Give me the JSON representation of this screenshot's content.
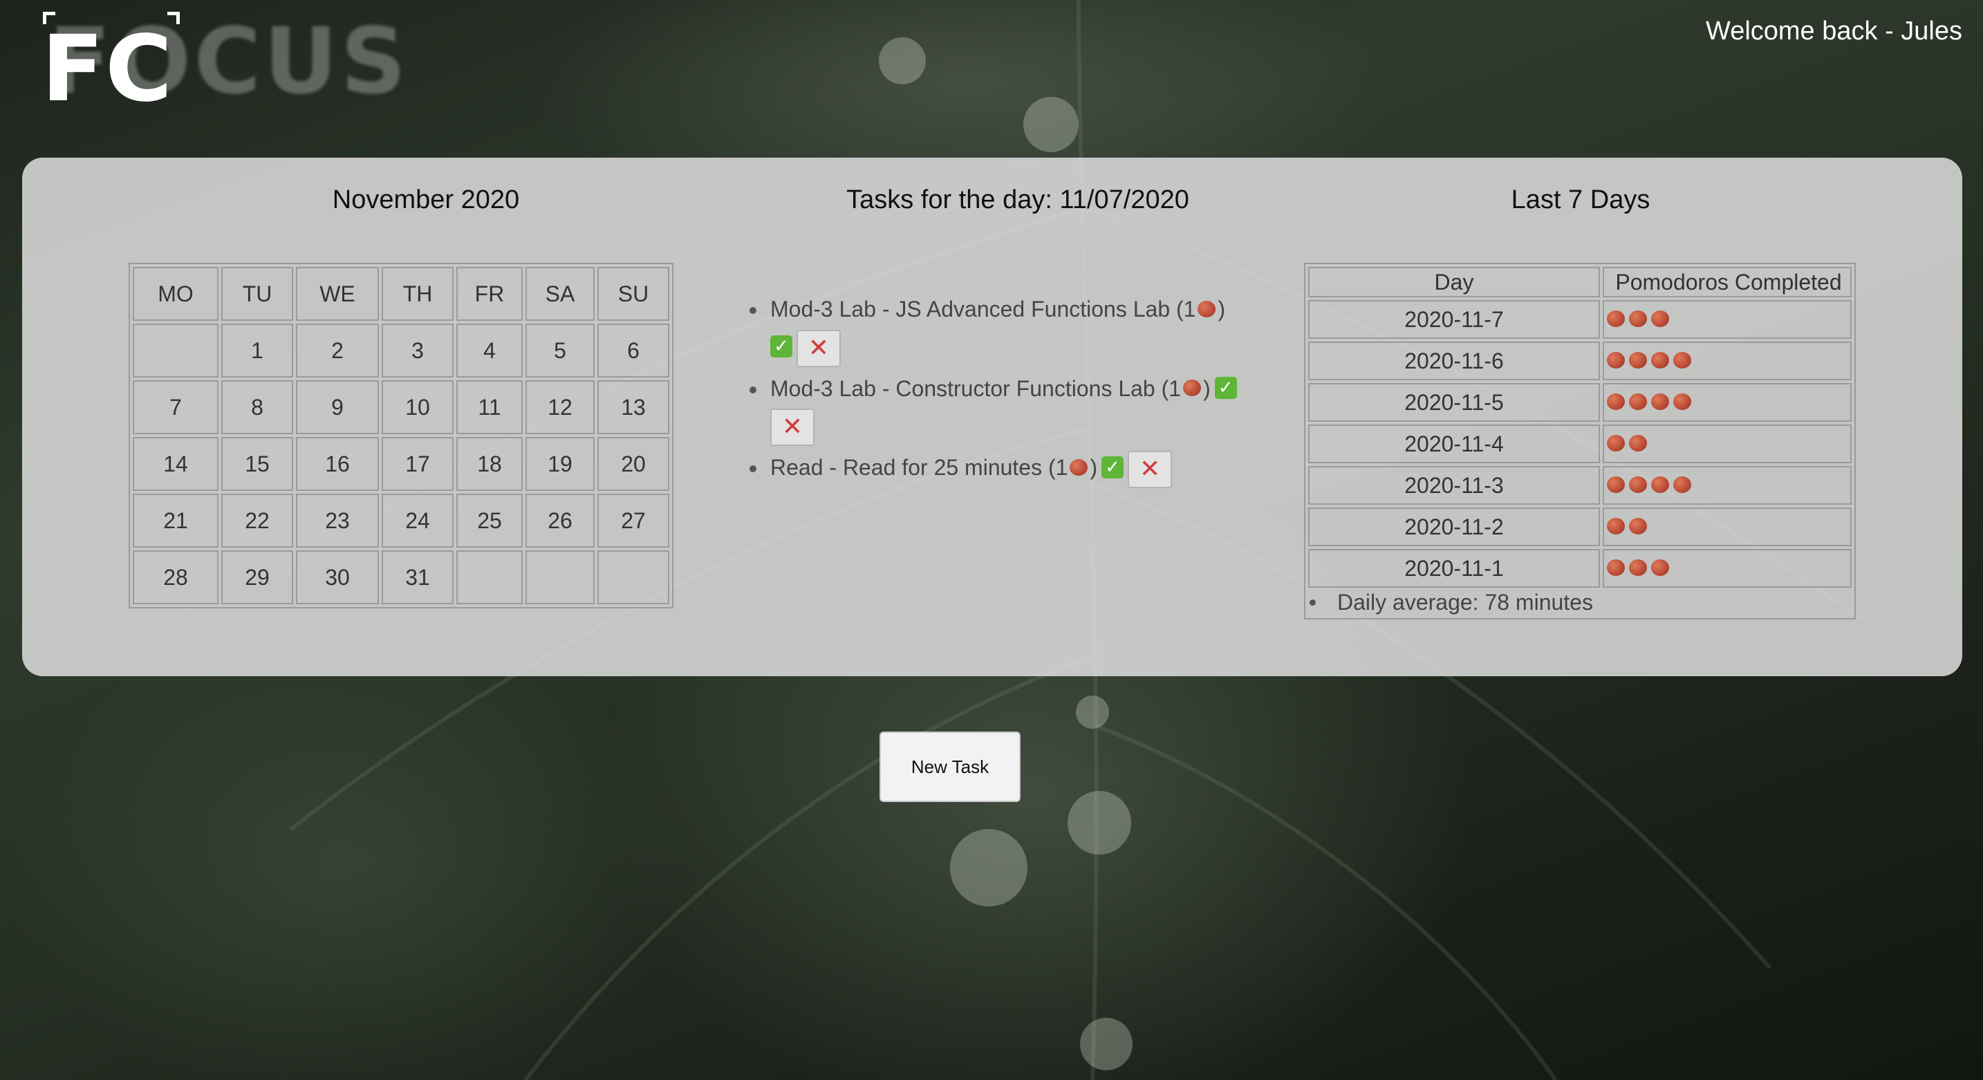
{
  "header": {
    "logo_text": "FOCUS",
    "logo_short": "FC",
    "welcome": "Welcome back - Jules"
  },
  "calendar": {
    "title": "November 2020",
    "weekdays": [
      "MO",
      "TU",
      "WE",
      "TH",
      "FR",
      "SA",
      "SU"
    ],
    "weeks": [
      [
        "",
        "1",
        "2",
        "3",
        "4",
        "5",
        "6"
      ],
      [
        "7",
        "8",
        "9",
        "10",
        "11",
        "12",
        "13"
      ],
      [
        "14",
        "15",
        "16",
        "17",
        "18",
        "19",
        "20"
      ],
      [
        "21",
        "22",
        "23",
        "24",
        "25",
        "26",
        "27"
      ],
      [
        "28",
        "29",
        "30",
        "31",
        "",
        "",
        ""
      ]
    ]
  },
  "tasks": {
    "title": "Tasks for the day: 11/07/2020",
    "items": [
      {
        "text": "Mod-3 Lab - JS Advanced Functions Lab (1",
        "close": ")",
        "pomodoros": 1,
        "completed": true
      },
      {
        "text": "Mod-3 Lab - Constructor Functions Lab (1",
        "close": ")",
        "pomodoros": 1,
        "completed": true
      },
      {
        "text": "Read - Read for 25 minutes (1",
        "close": ")",
        "pomodoros": 1,
        "completed": true
      }
    ],
    "delete_icon": "close-x-icon",
    "check_icon": "check-mark-icon"
  },
  "last7": {
    "title": "Last 7 Days",
    "headers": [
      "Day",
      "Pomodoros Completed"
    ],
    "rows": [
      {
        "day": "2020-11-7",
        "count": 3
      },
      {
        "day": "2020-11-6",
        "count": 4
      },
      {
        "day": "2020-11-5",
        "count": 4
      },
      {
        "day": "2020-11-4",
        "count": 2
      },
      {
        "day": "2020-11-3",
        "count": 4
      },
      {
        "day": "2020-11-2",
        "count": 2
      },
      {
        "day": "2020-11-1",
        "count": 3
      }
    ],
    "average": "Daily average: 78 minutes"
  },
  "actions": {
    "new_task": "New Task"
  },
  "colors": {
    "panel_bg": "#e2e2e2",
    "check_green": "#5fb537",
    "delete_red": "#d13b3b",
    "tomato": "#b94a35"
  }
}
